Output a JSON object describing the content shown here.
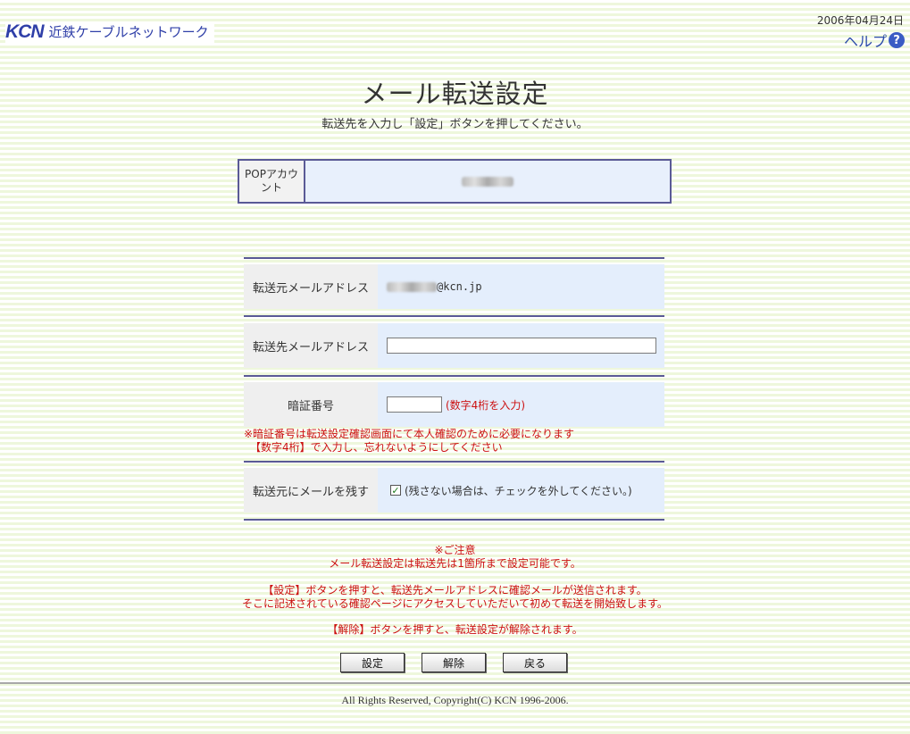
{
  "header": {
    "logo_mark": "KCN",
    "logo_text": "近鉄ケーブルネットワーク",
    "date": "2006年04月24日",
    "help_label": "ヘルプ",
    "help_icon_glyph": "?"
  },
  "page": {
    "title": "メール転送設定",
    "subtitle": "転送先を入力し「設定」ボタンを押してください。"
  },
  "pop_account": {
    "label": "POPアカウント",
    "value": ""
  },
  "form": {
    "source": {
      "label": "転送元メールアドレス",
      "domain_suffix": "@kcn.jp"
    },
    "destination": {
      "label": "転送先メールアドレス",
      "value": ""
    },
    "pin": {
      "label": "暗証番号",
      "value": "",
      "hint": "(数字4桁を入力)",
      "note_line1": "※暗証番号は転送設定確認画面にて本人確認のために必要になります",
      "note_line2": "【数字4桁】で入力し、忘れないようにしてください"
    },
    "keep": {
      "label": "転送元にメールを残す",
      "checked": true,
      "text": "(残さない場合は、チェックを外してください。)"
    }
  },
  "notice": {
    "heading": "※ご注意",
    "line1": "メール転送設定は転送先は1箇所まで設定可能です。",
    "line2": "【設定】ボタンを押すと、転送先メールアドレスに確認メールが送信されます。",
    "line3": "そこに記述されている確認ページにアクセスしていただいて初めて転送を開始致します。",
    "line4": "【解除】ボタンを押すと、転送設定が解除されます。"
  },
  "buttons": {
    "set": "設定",
    "cancel": "解除",
    "back": "戻る"
  },
  "footer": {
    "copyright": "All Rights Reserved, Copyright(C) KCN 1996-2006."
  },
  "colors": {
    "brand": "#2f3fa8",
    "warning": "#cc1111",
    "row_background": "#e4eefc",
    "divider": "#5a5a96"
  }
}
